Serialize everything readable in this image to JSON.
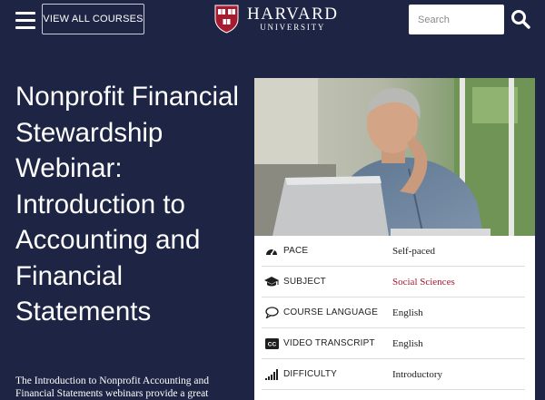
{
  "header": {
    "view_all_label": "VIEW ALL COURSES",
    "logo_main": "HARVARD",
    "logo_sub": "UNIVERSITY",
    "search_placeholder": "Search"
  },
  "course": {
    "title": "Nonprofit Financial Stewardship Webinar: Introduction to Accounting and Financial Statements",
    "description": "The Introduction to Nonprofit Accounting and Financial Statements webinars provide a great"
  },
  "details": [
    {
      "icon": "speedometer-icon",
      "label": "PACE",
      "value": "Self-paced"
    },
    {
      "icon": "graduation-cap-icon",
      "label": "SUBJECT",
      "value": "Social Sciences"
    },
    {
      "icon": "speech-bubble-icon",
      "label": "COURSE LANGUAGE",
      "value": "English"
    },
    {
      "icon": "closed-caption-icon",
      "label": "VIDEO TRANSCRIPT",
      "value": "English"
    },
    {
      "icon": "signal-bars-icon",
      "label": "DIFFICULTY",
      "value": "Introductory"
    }
  ],
  "colors": {
    "background": "#1e2443",
    "accent_link": "#a6192e",
    "crimson": "#a51c30"
  }
}
